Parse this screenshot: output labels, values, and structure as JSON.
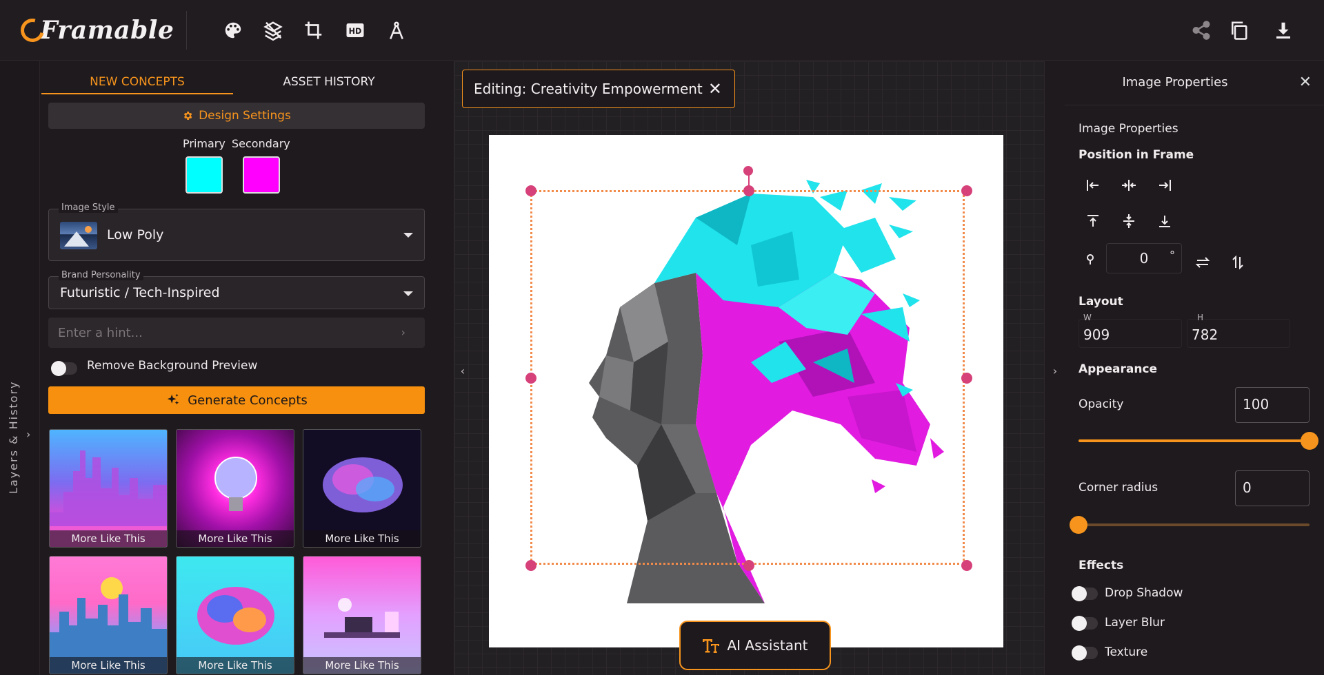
{
  "app": {
    "logo_text": "Framable",
    "toolbar_icons": [
      "palette-icon",
      "layers-icon",
      "crop-icon",
      "hd-icon",
      "compass-icon"
    ],
    "right_icons": [
      "share-icon",
      "copy-icon",
      "download-icon"
    ]
  },
  "left_rail": {
    "label": "Layers & History"
  },
  "left_panel": {
    "tabs": [
      {
        "label": "NEW CONCEPTS",
        "active": true
      },
      {
        "label": "ASSET HISTORY",
        "active": false
      }
    ],
    "design_settings_label": "Design Settings",
    "primary_label": "Primary",
    "secondary_label": "Secondary",
    "primary_color": "#00ffff",
    "secondary_color": "#ff00ff",
    "image_style": {
      "label": "Image Style",
      "value": "Low Poly"
    },
    "brand_personality": {
      "label": "Brand Personality",
      "value": "Futuristic / Tech-Inspired"
    },
    "hint_placeholder": "Enter a hint...",
    "remove_bg_label": "Remove Background Preview",
    "remove_bg_on": false,
    "generate_label": "Generate Concepts",
    "concepts": [
      {
        "caption": "More Like This",
        "thumb": "city-skyline"
      },
      {
        "caption": "More Like This",
        "thumb": "lightbulb"
      },
      {
        "caption": "More Like This",
        "thumb": "brain-dark"
      },
      {
        "caption": "More Like This",
        "thumb": "sunset-city"
      },
      {
        "caption": "More Like This",
        "thumb": "brain-colorful"
      },
      {
        "caption": "More Like This",
        "thumb": "office"
      }
    ]
  },
  "canvas": {
    "editing_label": "Editing: Creativity Empowerment",
    "ai_assistant_label": "AI Assistant"
  },
  "right_panel": {
    "header_title": "Image Properties",
    "section_title": "Image Properties",
    "position_label": "Position in Frame",
    "rotation_value": "0",
    "rotation_unit": "°",
    "layout_label": "Layout",
    "w_label": "W",
    "h_label": "H",
    "width_value": "909",
    "height_value": "782",
    "appearance_label": "Appearance",
    "opacity_label": "Opacity",
    "opacity_value": "100",
    "corner_radius_label": "Corner radius",
    "corner_radius_value": "0",
    "effects_label": "Effects",
    "effects": [
      {
        "label": "Drop Shadow",
        "on": false
      },
      {
        "label": "Layer Blur",
        "on": false
      },
      {
        "label": "Texture",
        "on": false
      }
    ]
  },
  "colors": {
    "accent": "#f7941d",
    "handle": "#d6417a",
    "background": "#1e1a1d"
  }
}
